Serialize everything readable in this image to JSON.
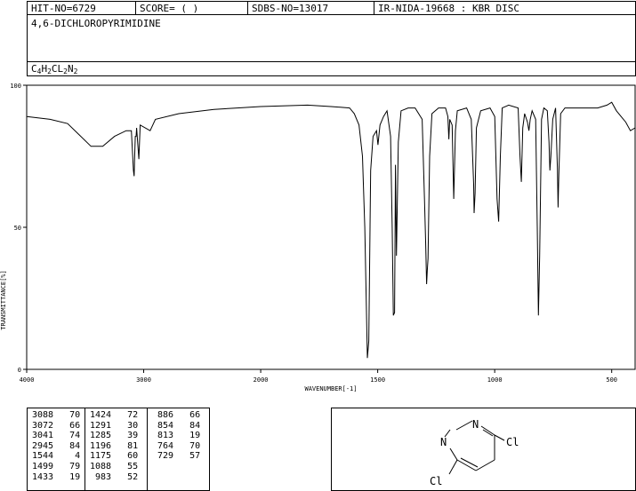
{
  "header": {
    "hit_no": "HIT-NO=6729",
    "score": "SCORE=  (   )",
    "sdbs_no": "SDBS-NO=13017",
    "ir_nida": "IR-NIDA-19668 : KBR DISC"
  },
  "compound": {
    "name": "4,6-DICHLOROPYRIMIDINE",
    "formula_parts": [
      {
        "t": "C",
        "sub": false
      },
      {
        "t": "4",
        "sub": true
      },
      {
        "t": "H",
        "sub": false
      },
      {
        "t": "2",
        "sub": true
      },
      {
        "t": "CL",
        "sub": false
      },
      {
        "t": "2",
        "sub": true
      },
      {
        "t": "N",
        "sub": false
      },
      {
        "t": "2",
        "sub": true
      }
    ]
  },
  "chart_data": {
    "type": "line",
    "xlabel": "WAVENUMBER[-1]",
    "ylabel": "TRANSMITTANCE[%]",
    "x_ticks": [
      4000,
      3000,
      2000,
      1500,
      1000,
      500
    ],
    "y_ticks": [
      100,
      50,
      0
    ],
    "xlim": [
      4000,
      400
    ],
    "ylim": [
      0,
      100
    ],
    "series": [
      {
        "points": [
          [
            4000,
            89
          ],
          [
            3800,
            88
          ],
          [
            3650,
            86.5
          ],
          [
            3550,
            82.5
          ],
          [
            3450,
            78.5
          ],
          [
            3350,
            78.5
          ],
          [
            3250,
            82
          ],
          [
            3150,
            84
          ],
          [
            3105,
            84
          ],
          [
            3088,
            70
          ],
          [
            3082,
            68
          ],
          [
            3076,
            76
          ],
          [
            3072,
            82
          ],
          [
            3065,
            82
          ],
          [
            3060,
            85
          ],
          [
            3041,
            74
          ],
          [
            3030,
            86
          ],
          [
            2945,
            84
          ],
          [
            2900,
            88
          ],
          [
            2700,
            90
          ],
          [
            2400,
            91.5
          ],
          [
            2200,
            92
          ],
          [
            2000,
            92.5
          ],
          [
            1800,
            93
          ],
          [
            1700,
            92.5
          ],
          [
            1620,
            92
          ],
          [
            1600,
            90
          ],
          [
            1580,
            86
          ],
          [
            1565,
            75
          ],
          [
            1555,
            50
          ],
          [
            1548,
            20
          ],
          [
            1544,
            4
          ],
          [
            1538,
            10
          ],
          [
            1530,
            70
          ],
          [
            1520,
            82
          ],
          [
            1505,
            84
          ],
          [
            1499,
            79
          ],
          [
            1490,
            86
          ],
          [
            1475,
            89
          ],
          [
            1460,
            91
          ],
          [
            1445,
            82
          ],
          [
            1438,
            50
          ],
          [
            1433,
            19
          ],
          [
            1428,
            20
          ],
          [
            1424,
            72
          ],
          [
            1420,
            40
          ],
          [
            1412,
            80
          ],
          [
            1400,
            91
          ],
          [
            1370,
            92
          ],
          [
            1340,
            92
          ],
          [
            1310,
            88
          ],
          [
            1300,
            60
          ],
          [
            1295,
            45
          ],
          [
            1291,
            30
          ],
          [
            1288,
            35
          ],
          [
            1285,
            39
          ],
          [
            1278,
            75
          ],
          [
            1268,
            90
          ],
          [
            1240,
            92
          ],
          [
            1210,
            92
          ],
          [
            1200,
            89
          ],
          [
            1196,
            81
          ],
          [
            1192,
            88
          ],
          [
            1182,
            86
          ],
          [
            1175,
            60
          ],
          [
            1168,
            84
          ],
          [
            1160,
            91
          ],
          [
            1120,
            92
          ],
          [
            1100,
            88
          ],
          [
            1090,
            65
          ],
          [
            1088,
            55
          ],
          [
            1084,
            62
          ],
          [
            1078,
            85
          ],
          [
            1060,
            91
          ],
          [
            1020,
            92
          ],
          [
            1000,
            89
          ],
          [
            990,
            60
          ],
          [
            983,
            52
          ],
          [
            976,
            75
          ],
          [
            968,
            92
          ],
          [
            940,
            93
          ],
          [
            900,
            92
          ],
          [
            892,
            75
          ],
          [
            886,
            66
          ],
          [
            880,
            85
          ],
          [
            872,
            90
          ],
          [
            860,
            87
          ],
          [
            854,
            84
          ],
          [
            848,
            88
          ],
          [
            840,
            91
          ],
          [
            825,
            88
          ],
          [
            818,
            50
          ],
          [
            813,
            19
          ],
          [
            808,
            40
          ],
          [
            800,
            88
          ],
          [
            790,
            92
          ],
          [
            775,
            91
          ],
          [
            768,
            80
          ],
          [
            764,
            70
          ],
          [
            760,
            75
          ],
          [
            752,
            88
          ],
          [
            740,
            92
          ],
          [
            732,
            70
          ],
          [
            729,
            57
          ],
          [
            726,
            68
          ],
          [
            718,
            90
          ],
          [
            700,
            92
          ],
          [
            650,
            92
          ],
          [
            600,
            92
          ],
          [
            560,
            92
          ],
          [
            520,
            93
          ],
          [
            500,
            94
          ],
          [
            480,
            91
          ],
          [
            460,
            89
          ],
          [
            440,
            87
          ],
          [
            420,
            84
          ],
          [
            400,
            85
          ]
        ]
      }
    ]
  },
  "peaks": [
    [
      [
        3088,
        70
      ],
      [
        3072,
        66
      ],
      [
        3041,
        74
      ],
      [
        2945,
        84
      ],
      [
        1544,
        4
      ],
      [
        1499,
        79
      ],
      [
        1433,
        19
      ]
    ],
    [
      [
        1424,
        72
      ],
      [
        1291,
        30
      ],
      [
        1285,
        39
      ],
      [
        1196,
        81
      ],
      [
        1175,
        60
      ],
      [
        1088,
        55
      ],
      [
        983,
        52
      ]
    ],
    [
      [
        886,
        66
      ],
      [
        854,
        84
      ],
      [
        813,
        19
      ],
      [
        764,
        70
      ],
      [
        729,
        57
      ]
    ]
  ],
  "structure": {
    "atom_n1": "N",
    "atom_n2": "N",
    "atom_cl1": "Cl",
    "atom_cl2": "Cl"
  }
}
